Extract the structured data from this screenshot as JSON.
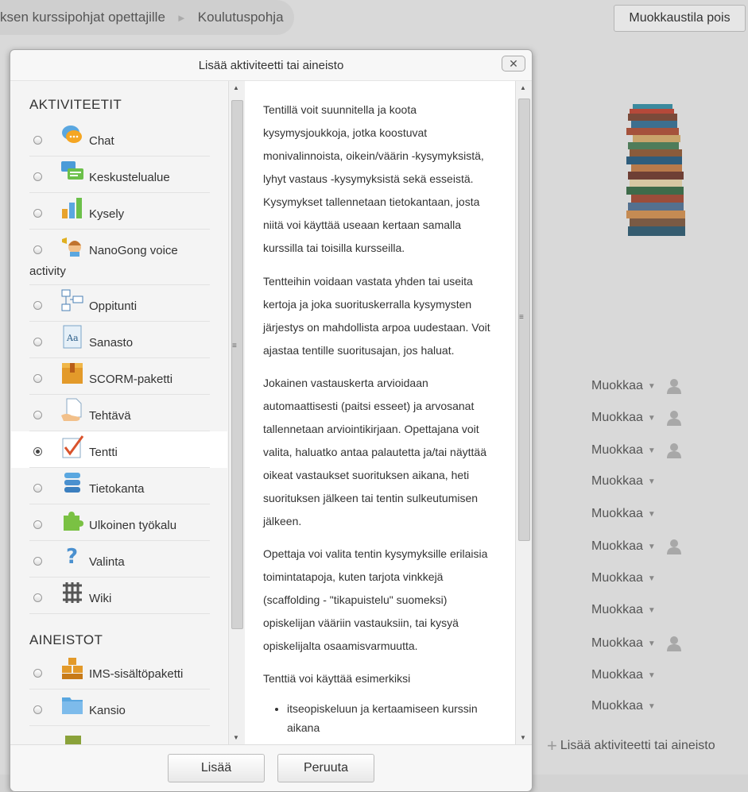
{
  "breadcrumb": {
    "items": [
      "ksen kurssipohjat opettajille",
      "Koulutuspohja"
    ],
    "separator": "►"
  },
  "header": {
    "edit_mode_button": "Muokkaustila pois"
  },
  "course": {
    "edit_label": "Muokkaa",
    "add_activity_link": "Lisää aktiviteetti tai aineisto"
  },
  "dialog": {
    "title": "Lisää aktiviteetti tai aineisto",
    "close_symbol": "✕",
    "activities_heading": "AKTIVITEETIT",
    "resources_heading": "AINEISTOT",
    "activities": [
      {
        "label": "Chat",
        "icon": "chat-icon"
      },
      {
        "label": "Keskustelualue",
        "icon": "forum-icon"
      },
      {
        "label": "Kysely",
        "icon": "survey-chart-icon"
      },
      {
        "label": "NanoGong voice",
        "label2": "activity",
        "icon": "nanogong-icon"
      },
      {
        "label": "Oppitunti",
        "icon": "lesson-icon"
      },
      {
        "label": "Sanasto",
        "icon": "glossary-icon"
      },
      {
        "label": "SCORM-paketti",
        "icon": "scorm-package-icon"
      },
      {
        "label": "Tehtävä",
        "icon": "assignment-icon"
      },
      {
        "label": "Tentti",
        "icon": "quiz-icon",
        "selected": true
      },
      {
        "label": "Tietokanta",
        "icon": "database-icon"
      },
      {
        "label": "Ulkoinen työkalu",
        "icon": "puzzle-icon"
      },
      {
        "label": "Valinta",
        "icon": "question-icon"
      },
      {
        "label": "Wiki",
        "icon": "wiki-icon"
      }
    ],
    "resources": [
      {
        "label": "IMS-sisältöpaketti",
        "icon": "ims-package-icon"
      },
      {
        "label": "Kansio",
        "icon": "folder-icon"
      }
    ],
    "help": {
      "p1": "Tentillä voit suunnitella ja koota kysymysjoukkoja, jotka koostuvat monivalinnoista, oikein/väärin -kysymyksistä, lyhyt vastaus -kysymyksistä sekä esseistä. Kysymykset tallennetaan tietokantaan, josta niitä voi käyttää useaan kertaan samalla kurssilla tai toisilla kursseilla.",
      "p2": "Tentteihin voidaan vastata yhden tai useita kertoja ja joka suorituskerralla kysymysten järjestys on mahdollista arpoa uudestaan. Voit ajastaa tentille suoritusajan, jos haluat.",
      "p3": "Jokainen vastauskerta arvioidaan automaattisesti (paitsi esseet) ja arvosanat tallennetaan arviointikirjaan. Opettajana voit valita, haluatko antaa palautetta ja/tai näyttää oikeat vastaukset suorituksen aikana, heti suorituksen jälkeen tai tentin sulkeutumisen jälkeen.",
      "p4": "Opettaja voi valita tentin kysymyksille erilaisia toimintatapoja, kuten tarjota vinkkejä (scaffolding - \"tikapuistelu\" suomeksi) opiskelijan vääriin vastauksiin, tai kysyä opiskelijalta osaamisvarmuutta.",
      "p5": "Tenttiä voi käyttää esimerkiksi",
      "list": [
        "itseopiskeluun ja kertaamiseen kurssin aikana"
      ]
    },
    "buttons": {
      "add": "Lisää",
      "cancel": "Peruuta"
    }
  }
}
